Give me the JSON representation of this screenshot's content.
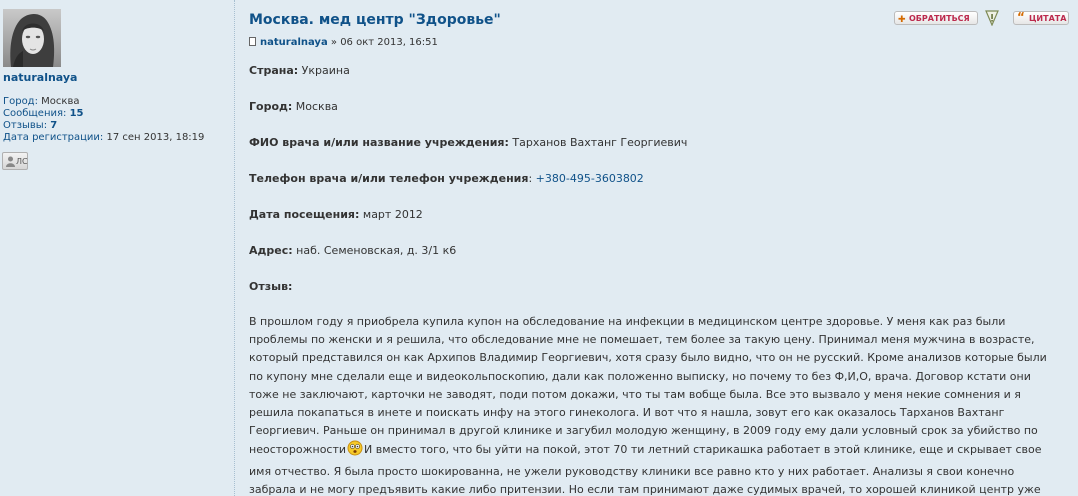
{
  "profile": {
    "username": "naturalnaya",
    "city_label": "Город:",
    "city_value": "Москва",
    "posts_label": "Сообщения:",
    "posts_value": "15",
    "reviews_label": "Отзывы:",
    "reviews_value": "7",
    "reg_label": "Дата регистрации:",
    "reg_value": "17 сен 2013, 18:19",
    "pm_label": "ЛС"
  },
  "post": {
    "title": "Москва. мед центр \"Здоровье\"",
    "author": "naturalnaya",
    "date": "» 06 окт 2013, 16:51",
    "buttons": {
      "contact": "ОБРАТИТЬСЯ",
      "quote": "ЦИТАТА"
    },
    "fields": [
      {
        "label": "Страна:",
        "value": "Украина"
      },
      {
        "label": "Город:",
        "value": "Москва"
      },
      {
        "label": "ФИО врача и/или название учреждения:",
        "value": "Тарханов Вахтанг Георгиевич"
      },
      {
        "label": "Телефон врача и/или телефон учреждения",
        "sep": ":",
        "value": "+380-495-3603802"
      },
      {
        "label": "Дата посещения:",
        "value": "март 2012"
      },
      {
        "label": "Адрес:",
        "value": "наб. Семеновская, д. 3/1 к6"
      },
      {
        "label": "Отзыв:",
        "value": ""
      }
    ],
    "review_lines": [
      "В прошлом году я приобрела купила купон на обследование на инфекции в медицинском центре здоровье. У меня как раз были",
      "проблемы по женски и я решила, что обследование мне не помешает, тем более за такую цену. Принимал меня мужчина в возрасте,",
      "который представился он как Архипов Владимир Георгиевич, хотя сразу было видно, что он не русский. Кроме анализов которые были",
      "по купону мне сделали еще и видеокольпоскопию, дали как положенно выписку, но почему то без Ф,И,О, врача. Договор кстати они",
      "тоже не заключают, карточки не заводят, поди потом докажи, что ты там вобще была. Все это вызвало у меня некие сомнения и я",
      "решила покапаться в инете и поискать инфу на этого гинеколога. И вот что я нашла, зовут его как оказалось Тарханов Вахтанг",
      "Георгиевич. Раньше он принимал в другой клинике и загубил молодую женщину, в 2009 году ему дали условный срок за убийство по"
    ],
    "review_line8_a": "неосторожности",
    "review_line8_b": "И вместо того, что бы уйти на покой, этот 70 ти летний старикашка работает в этой клинике, еще и скрывает свое",
    "review_lines_tail": [
      "имя отчество. Я была просто шокированна, не ужели руководству клиники все равно кто у них работает. Анализы я свои конечно",
      "забрала и не могу предъявить какие либо притензии. Но если там принимают даже судимых врачей, то хорошей клиникой центр уже"
    ]
  },
  "colors": {
    "background": "#e1ebf2",
    "link": "#105289",
    "button_text": "#bc2a4d"
  },
  "icons": [
    "avatar-photo",
    "pm-user-icon",
    "contact-icon",
    "report-warning-icon",
    "quote-icon",
    "post-doc-icon",
    "surprised-smiley-icon"
  ]
}
